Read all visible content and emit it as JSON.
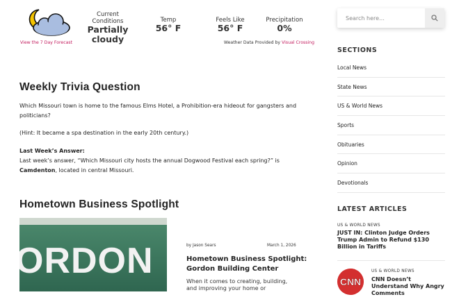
{
  "weather": {
    "icon": "cloudy-moon-icon",
    "conditions_label": "Current Conditions",
    "conditions_value_1": "Partially",
    "conditions_value_2": "cloudy",
    "temp_label": "Temp",
    "temp_value": "56° F",
    "feels_label": "Feels Like",
    "feels_value": "56° F",
    "precip_label": "Precipitation",
    "precip_value": "0%",
    "forecast_link": "View the 7 Day Forecast",
    "provided_text": "Weather Data Provided by",
    "provided_link": "Visual Crossing"
  },
  "trivia": {
    "title": "Weekly Trivia Question",
    "question": "Which Missouri town is home to the famous Elms Hotel, a Prohibition-era hideout for gangsters and politicians?",
    "hint": "(Hint: It became a spa destination in the early 20th century.)",
    "answer_heading": "Last Week’s Answer:",
    "answer_prefix": "Last week’s answer, “Which Missouri city hosts the annual Dogwood Festival each spring?” is ",
    "answer_bold": "Camdenton",
    "answer_suffix": ", located in central Missouri."
  },
  "spotlight": {
    "section_title": "Hometown Business Spotlight",
    "image_text": "ORDON",
    "byline": "by Jason Sears",
    "date": "March 1, 2026",
    "headline": "Hometown Business Spotlight: Gordon Building Center",
    "excerpt": "When it comes to creating, building, and improving your home or"
  },
  "search": {
    "placeholder": "Search here…"
  },
  "sidebar": {
    "sections_heading": "SECTIONS",
    "sections": [
      "Local News",
      "State News",
      "US & World News",
      "Sports",
      "Obituaries",
      "Opinion",
      "Devotionals"
    ],
    "latest_heading": "LATEST ARTICLES",
    "articles": [
      {
        "category": "US & WORLD NEWS",
        "title": "JUST IN: Clinton Judge Orders Trump Admin to Refund $130 Billion in Tariffs"
      },
      {
        "category": "US & WORLD NEWS",
        "title": "CNN Doesn’t Understand Why Angry Comments",
        "thumb_text": "CNN"
      }
    ]
  },
  "colors": {
    "link": "#c2185b",
    "cnn_red": "#d32f2f"
  }
}
